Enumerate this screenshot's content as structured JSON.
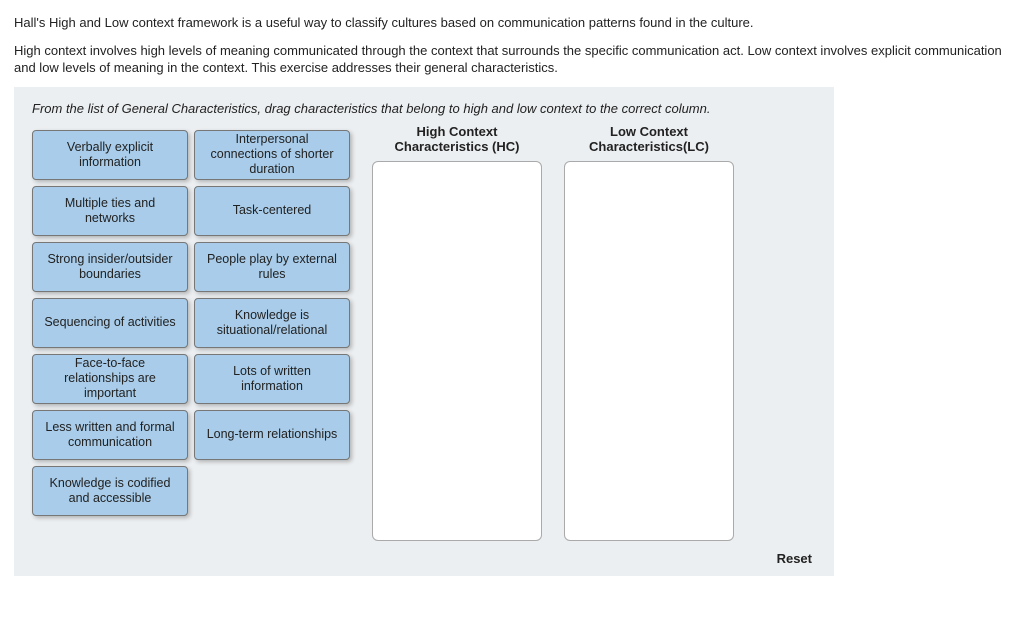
{
  "intro": {
    "p1": "Hall's High and Low context framework is a useful way to classify cultures based on communication patterns found in the culture.",
    "p2": "High context involves high levels of meaning communicated through the context that surrounds the specific communication act. Low context involves explicit communication and low levels of meaning in the context. This exercise addresses their general characteristics."
  },
  "exercise": {
    "instruction": "From the list of General Characteristics, drag characteristics that belong to high and low context to the correct column.",
    "cards": [
      "Verbally explicit information",
      "Interpersonal connections of shorter duration",
      "Multiple ties and networks",
      "Task-centered",
      "Strong insider/outsider boundaries",
      "People play by external rules",
      "Sequencing of activities",
      "Knowledge is situational/relational",
      "Face-to-face relationships are important",
      "Lots of written information",
      "Less written and formal communication",
      "Long-term relationships",
      "Knowledge is codified and accessible"
    ],
    "hc_title": "High Context Characteristics (HC)",
    "lc_title": "Low Context Characteristics(LC)",
    "reset_label": "Reset"
  }
}
